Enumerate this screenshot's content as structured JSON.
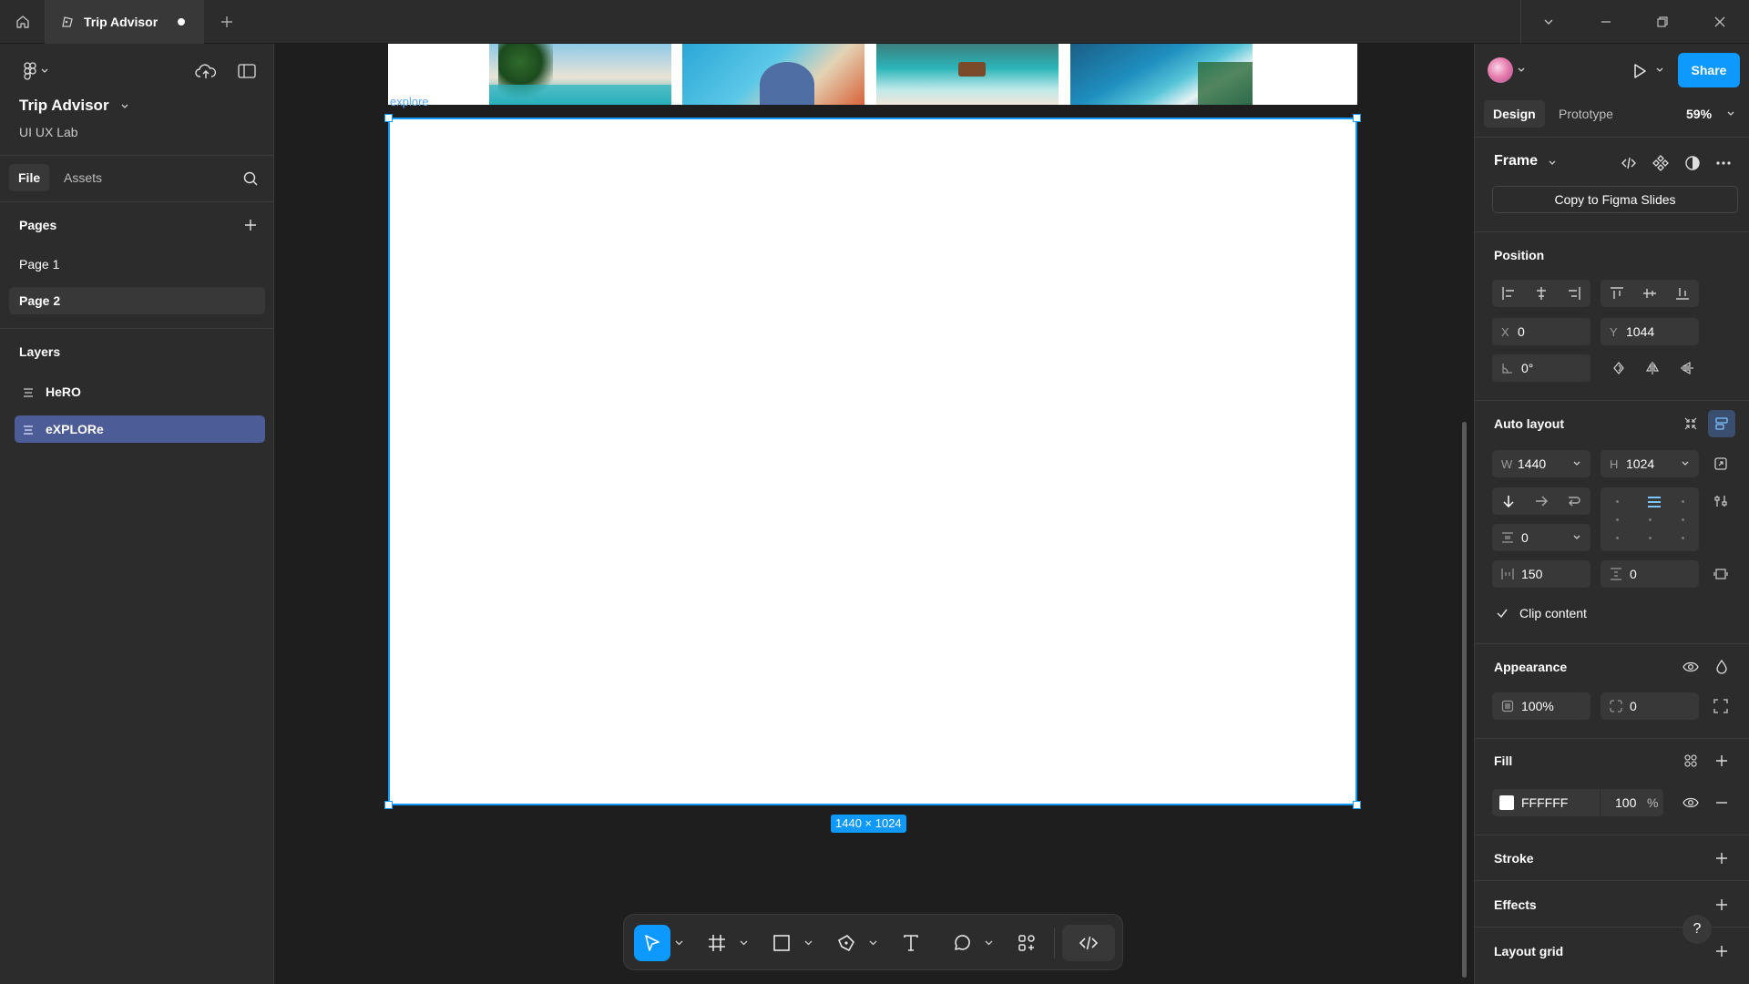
{
  "titlebar": {
    "tab_title": "Trip Advisor"
  },
  "left_panel": {
    "file_name": "Trip Advisor",
    "team_name": "UI UX Lab",
    "tabs": {
      "file": "File",
      "assets": "Assets"
    },
    "pages_title": "Pages",
    "pages": [
      {
        "label": "Page 1",
        "selected": false
      },
      {
        "label": "Page 2",
        "selected": true
      }
    ],
    "layers_title": "Layers",
    "layers": [
      {
        "label": "HeRO",
        "selected": false
      },
      {
        "label": "eXPLORe",
        "selected": true
      }
    ]
  },
  "canvas": {
    "frame_label": "explore",
    "size_badge": "1440 × 1024",
    "accent": "#0d99ff"
  },
  "right_panel": {
    "share_label": "Share",
    "tabs": {
      "design": "Design",
      "prototype": "Prototype"
    },
    "zoom": "59%",
    "frame_label": "Frame",
    "copy_slides_label": "Copy to Figma Slides",
    "position": {
      "title": "Position",
      "x_label": "X",
      "x_value": "0",
      "y_label": "Y",
      "y_value": "1044",
      "rotation": "0°"
    },
    "auto_layout": {
      "title": "Auto layout",
      "w_label": "W",
      "w_value": "1440",
      "h_label": "H",
      "h_value": "1024",
      "gap": "0",
      "padding_h": "150",
      "padding_v": "0",
      "clip_label": "Clip content"
    },
    "appearance": {
      "title": "Appearance",
      "opacity": "100%",
      "radius": "0"
    },
    "fill": {
      "title": "Fill",
      "hex": "FFFFFF",
      "opacity": "100",
      "unit": "%"
    },
    "stroke_title": "Stroke",
    "effects_title": "Effects",
    "layout_grid_title": "Layout grid",
    "help": "?"
  }
}
